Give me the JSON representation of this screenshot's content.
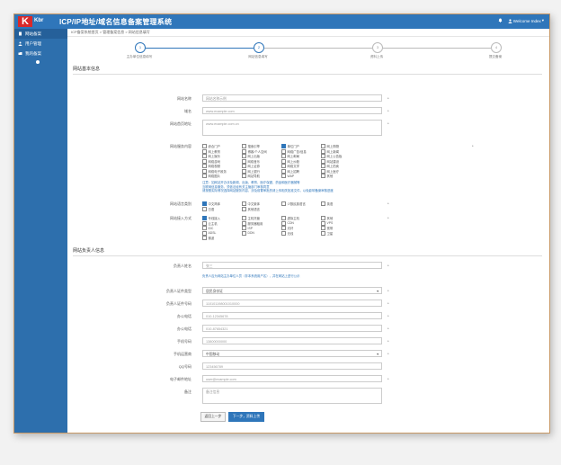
{
  "header": {
    "logo_letter": "K",
    "logo_text": "Kbr",
    "system_title": "ICP/IP地址/域名信息备案管理系统",
    "bell_icon": "bell-icon",
    "user_label": "Welcome Index"
  },
  "sidebar": {
    "items": [
      {
        "label": "网站备案",
        "icon": "file-icon"
      },
      {
        "label": "用户管理",
        "icon": "user-icon"
      },
      {
        "label": "我的备案",
        "icon": "folder-icon"
      }
    ]
  },
  "breadcrumb": "ICP备案系统首页 > 管理备案信息 > 网站信息填写",
  "steps": [
    {
      "label": "主办单位信息填写",
      "number": "1"
    },
    {
      "label": "网站信息填写",
      "number": "2"
    },
    {
      "label": "资料上传",
      "number": "3"
    },
    {
      "label": "提交备案",
      "number": "4"
    }
  ],
  "site_info": {
    "section_title": "网站基本信息",
    "site_name_label": "网站名称",
    "site_name_value": "网站名称示例",
    "domain_label": "域名",
    "domain_value": "www.example.com",
    "home_url_label": "网站首页地址",
    "home_url_value": "www.example.com.cn",
    "service_label": "网站服务内容",
    "service_options": [
      {
        "label": "综合门户",
        "checked": false
      },
      {
        "label": "搜索引擎",
        "checked": false
      },
      {
        "label": "单位门户",
        "checked": true
      },
      {
        "label": "网上购物",
        "checked": false
      },
      {
        "label": "网上教育",
        "checked": false
      },
      {
        "label": "博客/个人空间",
        "checked": false
      },
      {
        "label": "网络广告/信息",
        "checked": false
      },
      {
        "label": "网上新闻",
        "checked": false
      },
      {
        "label": "网上娱乐",
        "checked": false
      },
      {
        "label": "网上出版",
        "checked": false
      },
      {
        "label": "网上邮局",
        "checked": false
      },
      {
        "label": "网上公告板",
        "checked": false
      },
      {
        "label": "网络游戏",
        "checked": false
      },
      {
        "label": "网络音乐",
        "checked": false
      },
      {
        "label": "网上炒股",
        "checked": false
      },
      {
        "label": "网站建设",
        "checked": false
      },
      {
        "label": "网络视频",
        "checked": false
      },
      {
        "label": "网上证券",
        "checked": false
      },
      {
        "label": "网络文学",
        "checked": false
      },
      {
        "label": "网上拍卖",
        "checked": false
      },
      {
        "label": "网络电子政务",
        "checked": false
      },
      {
        "label": "网上银行",
        "checked": false
      },
      {
        "label": "网上招聘",
        "checked": false
      },
      {
        "label": "网上医疗",
        "checked": false
      },
      {
        "label": "网络图片",
        "checked": false
      },
      {
        "label": "网站导航",
        "checked": false
      },
      {
        "label": "WAP",
        "checked": false
      },
      {
        "label": "其他",
        "checked": false
      }
    ],
    "service_note_1": "注意：如网站开办涉及新闻、出版、教育、医疗保健、药品和医疗器械等",
    "service_note_2": "互联网信息服务，须依法经有关主管部门审核同意",
    "service_note_3": "请按照实际情况选择网站服务内容，涉及前置审批的请上传相关批准文件，以免影响备案审核进度",
    "language_label": "网站语言类别",
    "language_options": [
      {
        "label": "中文简体",
        "checked": true
      },
      {
        "label": "中文繁体",
        "checked": false
      },
      {
        "label": "少数民族语言",
        "checked": false
      },
      {
        "label": "英语",
        "checked": false
      },
      {
        "label": "日语",
        "checked": false
      },
      {
        "label": "其他语言",
        "checked": false
      }
    ],
    "access_label": "网站接入方式",
    "access_options": [
      {
        "label": "专线接入",
        "checked": true
      },
      {
        "label": "主机托管",
        "checked": false
      },
      {
        "label": "虚拟主机",
        "checked": false
      },
      {
        "label": "其他",
        "checked": false
      },
      {
        "label": "云主机",
        "checked": false
      },
      {
        "label": "服务器租用",
        "checked": false
      },
      {
        "label": "CDN",
        "checked": false
      },
      {
        "label": "VPS",
        "checked": false
      },
      {
        "label": "IDC",
        "checked": false
      },
      {
        "label": "ISP",
        "checked": false
      },
      {
        "label": "光纤",
        "checked": false
      },
      {
        "label": "宽带",
        "checked": false
      },
      {
        "label": "ADSL",
        "checked": false
      },
      {
        "label": "DDN",
        "checked": false
      },
      {
        "label": "无线",
        "checked": false
      },
      {
        "label": "卫星",
        "checked": false
      },
      {
        "label": "微波",
        "checked": false
      }
    ]
  },
  "owner_info": {
    "section_title": "网站负责人信息",
    "name_label": "负责人姓名",
    "name_value": "张三",
    "name_note": "负责人应为网站主办单位人员（非本系统用户名），并在网站上进行公示",
    "id_type_label": "负责人证件类型",
    "id_type_value": "居民身份证",
    "id_number_label": "负责人证件号码",
    "id_number_value": "110101198001010000",
    "office_phone_label": "办公电话",
    "office_phone_value": "010-12345678",
    "home_phone_label": "办公电话",
    "home_phone_value": "010-87654321",
    "mobile_label": "手机号码",
    "mobile_value": "13800000000",
    "carrier_label": "手机运营商",
    "carrier_value": "中国移动",
    "qq_label": "QQ号码",
    "qq_value": "123456789",
    "email_label": "电子邮件地址",
    "email_value": "user@example.com",
    "remark_label": "备注",
    "remark_value": "备注信息"
  },
  "buttons": {
    "prev": "返回上一步",
    "next": "下一步，资料上传"
  }
}
